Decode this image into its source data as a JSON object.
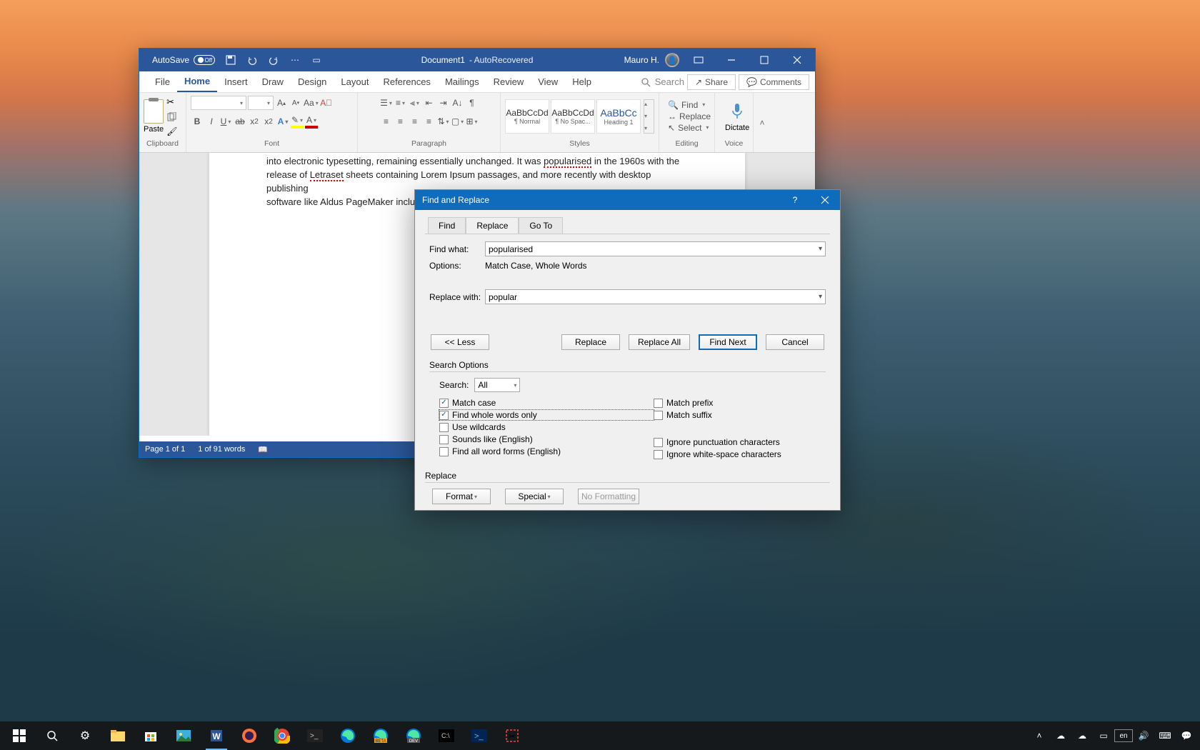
{
  "word": {
    "title_bar": {
      "autosave": "AutoSave",
      "autosave_state": "Off",
      "doc_name": "Document1",
      "doc_suffix": "- AutoRecovered",
      "user": "Mauro H."
    },
    "menu": {
      "file": "File",
      "home": "Home",
      "insert": "Insert",
      "draw": "Draw",
      "design": "Design",
      "layout": "Layout",
      "references": "References",
      "mailings": "Mailings",
      "review": "Review",
      "view": "View",
      "help": "Help",
      "tell_me": "Search",
      "share": "Share",
      "comments": "Comments"
    },
    "ribbon": {
      "clipboard": "Clipboard",
      "paste": "Paste",
      "font": "Font",
      "paragraph": "Paragraph",
      "styles": "Styles",
      "editing": "Editing",
      "voice": "Voice",
      "style1": "¶ Normal",
      "style2": "¶ No Spac...",
      "style3": "Heading 1",
      "style_prev": "AaBbCcDd",
      "style_prev2": "AaBbCcDd",
      "style_prev3": "AaBbCc",
      "find": "Find",
      "replace": "Replace",
      "select": "Select",
      "dictate": "Dictate"
    },
    "doc_text": {
      "line1a": "into electronic typesetting, remaining essentially unchanged. It was ",
      "line1b": "popularised",
      "line1c": " in the 1960s with the",
      "line2a": "release of ",
      "line2b": "Letraset",
      "line2c": " sheets containing Lorem Ipsum passages, and more recently with desktop publishing",
      "line3": "software like Aldus PageMaker including versions of Lorem Ipsum."
    },
    "status": {
      "page": "Page 1 of 1",
      "words": "1 of 91 words"
    }
  },
  "find_replace": {
    "title": "Find and Replace",
    "tabs": {
      "find": "Find",
      "replace": "Replace",
      "goto": "Go To"
    },
    "find_what_label": "Find what:",
    "find_what_value": "popularised",
    "options_label": "Options:",
    "options_value": "Match Case, Whole Words",
    "replace_with_label": "Replace with:",
    "replace_with_value": "popular",
    "buttons": {
      "less": "<< Less",
      "replace": "Replace",
      "replace_all": "Replace All",
      "find_next": "Find Next",
      "cancel": "Cancel"
    },
    "search_options": "Search Options",
    "search_label": "Search:",
    "search_value": "All",
    "chk_match_case": "Match case",
    "chk_whole_words": "Find whole words only",
    "chk_wildcards": "Use wildcards",
    "chk_sounds": "Sounds like (English)",
    "chk_word_forms": "Find all word forms (English)",
    "chk_prefix": "Match prefix",
    "chk_suffix": "Match suffix",
    "chk_punct": "Ignore punctuation characters",
    "chk_ws": "Ignore white-space characters",
    "replace_section": "Replace",
    "format": "Format",
    "special": "Special",
    "no_formatting": "No Formatting"
  },
  "taskbar": {
    "time": "",
    "date": ""
  }
}
